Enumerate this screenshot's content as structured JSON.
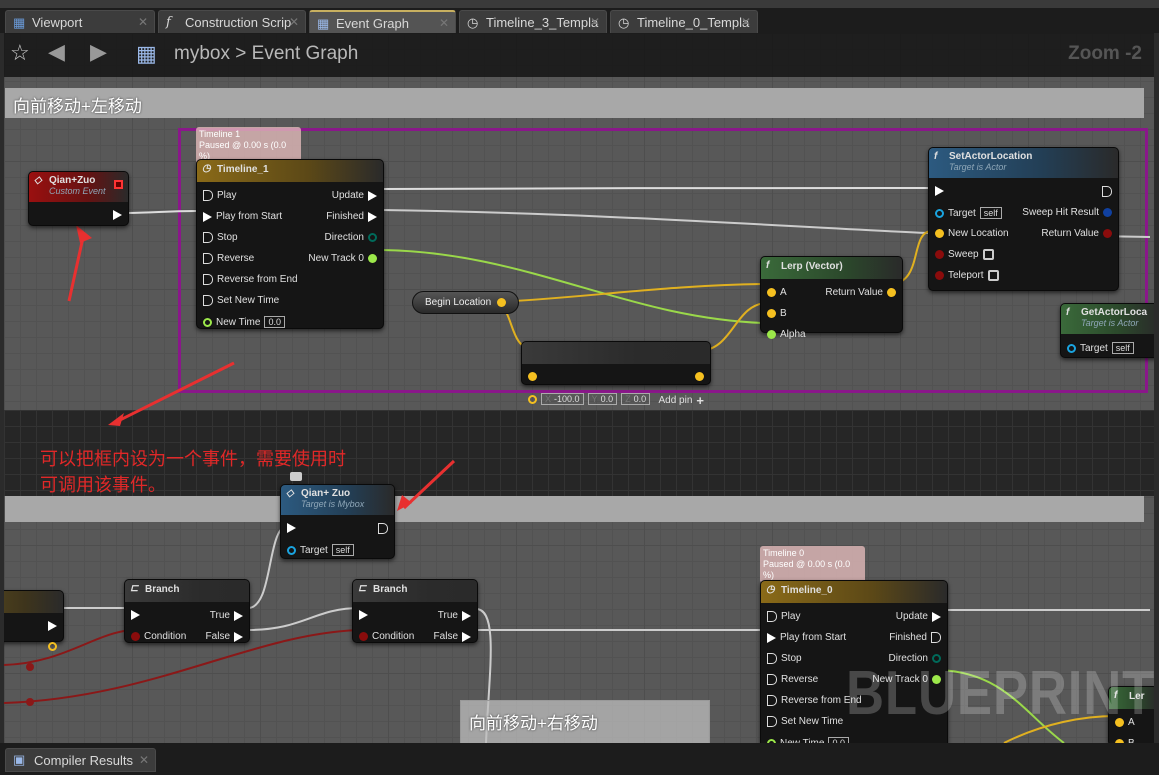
{
  "tabs": [
    {
      "label": "Viewport",
      "icon": "viewport-icon",
      "active": false
    },
    {
      "label": "Construction Scrip",
      "icon": "function-icon",
      "active": false
    },
    {
      "label": "Event Graph",
      "icon": "event-graph-icon",
      "active": true
    },
    {
      "label": "Timeline_3_Templa",
      "icon": "clock-icon",
      "active": false
    },
    {
      "label": "Timeline_0_Templa",
      "icon": "clock-icon",
      "active": false
    }
  ],
  "toolbar": {
    "breadcrumb_root": "mybox",
    "breadcrumb_sep": ">",
    "breadcrumb_current": "Event Graph",
    "zoom": "Zoom -2"
  },
  "comments": {
    "top": "向前移动+左移动",
    "middle": "",
    "bottom": "向前移动+右移动"
  },
  "annotation": {
    "line1": "可以把框内设为一个事件，需要使用时",
    "line2": "可调用该事件。"
  },
  "watermark": "BLUEPRINT",
  "tooltips": {
    "timeline1": {
      "line1": "Timeline 1",
      "line2": "Paused @ 0.00 s (0.0 %)"
    },
    "timeline0": {
      "line1": "Timeline 0",
      "line2": "Paused @ 0.00 s (0.0 %)"
    }
  },
  "begin_location": "Begin Location",
  "colors": {
    "exec": "#ffffff",
    "vector": "#f5c020",
    "float": "#9ce84a",
    "object": "#1aa4e0",
    "bool": "#8a0c0c",
    "struct": "#1040a0",
    "byte": "#006a5a",
    "comment_border": "#8a178a",
    "annotation": "#e02828"
  },
  "nodes": [
    {
      "id": "custom-event",
      "title": "Qian+Zuo",
      "subtitle": "Custom Event",
      "icon": "event-icon",
      "header": "#9a1010",
      "rows": [
        {
          "right": {
            "pin": "exec"
          }
        }
      ]
    },
    {
      "id": "timeline-1",
      "title": "Timeline_1",
      "icon": "clock-icon",
      "header": "#8a6a18",
      "rows": [
        {
          "left": {
            "pin": "exech",
            "label": "Play"
          },
          "right": {
            "pin": "exec",
            "label": "Update"
          }
        },
        {
          "left": {
            "pin": "exec",
            "label": "Play from Start"
          },
          "right": {
            "pin": "exec",
            "label": "Finished"
          }
        },
        {
          "left": {
            "pin": "exech",
            "label": "Stop"
          },
          "right": {
            "pin": "byte",
            "label": "Direction"
          }
        },
        {
          "left": {
            "pin": "exech",
            "label": "Reverse"
          },
          "right": {
            "pin": "float",
            "label": "New Track 0"
          }
        },
        {
          "left": {
            "pin": "exech",
            "label": "Reverse from End"
          }
        },
        {
          "left": {
            "pin": "exech",
            "label": "Set New Time"
          }
        },
        {
          "left": {
            "pin": "floath",
            "label": "New Time",
            "value": "0.0"
          }
        }
      ]
    },
    {
      "id": "make-vector",
      "title": "",
      "header": "#3a3a3a",
      "rows": [
        {
          "left": {
            "pin": "vector"
          },
          "right": {
            "pin": "vector"
          }
        },
        {
          "left": {
            "pin": "vectorh",
            "x": "X",
            "xv": "-100.0",
            "y": "Y",
            "yv": "0.0",
            "z": "Z",
            "zv": "0.0"
          },
          "right": {
            "label": "Add pin",
            "pin": "plus"
          }
        }
      ]
    },
    {
      "id": "lerp",
      "title": "Lerp (Vector)",
      "icon": "function-icon",
      "header": "#3a6a3a",
      "rows": [
        {
          "left": {
            "pin": "vector",
            "label": "A"
          },
          "right": {
            "pin": "vector",
            "label": "Return Value"
          }
        },
        {
          "left": {
            "pin": "vector",
            "label": "B"
          }
        },
        {
          "left": {
            "pin": "float",
            "label": "Alpha"
          }
        }
      ]
    },
    {
      "id": "set-actor-location",
      "title": "SetActorLocation",
      "subtitle": "Target is Actor",
      "icon": "function-icon",
      "header": "#2c5a80",
      "rows": [
        {
          "left": {
            "pin": "exec"
          },
          "right": {
            "pin": "exech"
          }
        },
        {
          "left": {
            "pin": "object",
            "label": "Target",
            "value": "self"
          },
          "right": {
            "pin": "struct",
            "label": "Sweep Hit Result"
          }
        },
        {
          "left": {
            "pin": "vector",
            "label": "New Location"
          },
          "right": {
            "pin": "bool",
            "label": "Return Value"
          }
        },
        {
          "left": {
            "pin": "bool",
            "label": "Sweep",
            "check": true
          }
        },
        {
          "left": {
            "pin": "bool",
            "label": "Teleport",
            "check": true
          }
        }
      ]
    },
    {
      "id": "get-actor-location",
      "title": "GetActorLoca",
      "subtitle": "Target is Actor",
      "icon": "function-icon",
      "header": "#3a6a3a",
      "rows": [
        {
          "left": {
            "pin": "object",
            "label": "Target",
            "value": "self"
          }
        }
      ]
    },
    {
      "id": "call-qian-zuo",
      "title": "Qian+ Zuo",
      "subtitle": "Target is Mybox",
      "icon": "event-icon",
      "header": "#2c5a80",
      "rows": [
        {
          "left": {
            "pin": "exec"
          },
          "right": {
            "pin": "exech"
          }
        },
        {
          "left": {
            "pin": "object",
            "label": "Target",
            "value": "self"
          }
        }
      ]
    },
    {
      "id": "partial-node",
      "title": "",
      "header": "#5a4a20",
      "rows": [
        {
          "right": {
            "pin": "exec"
          }
        },
        {
          "left": {
            "label": "tion"
          },
          "right": {
            "pin": "vectorh"
          }
        }
      ]
    },
    {
      "id": "branch-1",
      "title": "Branch",
      "icon": "branch-icon",
      "header": "#3a3a3a",
      "rows": [
        {
          "left": {
            "pin": "exec"
          },
          "right": {
            "pin": "exec",
            "label": "True"
          }
        },
        {
          "left": {
            "pin": "bool",
            "label": "Condition"
          },
          "right": {
            "pin": "exec",
            "label": "False"
          }
        }
      ]
    },
    {
      "id": "branch-2",
      "title": "Branch",
      "icon": "branch-icon",
      "header": "#3a3a3a",
      "rows": [
        {
          "left": {
            "pin": "exec"
          },
          "right": {
            "pin": "exec",
            "label": "True"
          }
        },
        {
          "left": {
            "pin": "bool",
            "label": "Condition"
          },
          "right": {
            "pin": "exec",
            "label": "False"
          }
        }
      ]
    },
    {
      "id": "timeline-0",
      "title": "Timeline_0",
      "icon": "clock-icon",
      "header": "#8a6a18",
      "rows": [
        {
          "left": {
            "pin": "exech",
            "label": "Play"
          },
          "right": {
            "pin": "exec",
            "label": "Update"
          }
        },
        {
          "left": {
            "pin": "exec",
            "label": "Play from Start"
          },
          "right": {
            "pin": "exech",
            "label": "Finished"
          }
        },
        {
          "left": {
            "pin": "exech",
            "label": "Stop"
          },
          "right": {
            "pin": "byte",
            "label": "Direction"
          }
        },
        {
          "left": {
            "pin": "exech",
            "label": "Reverse"
          },
          "right": {
            "pin": "float",
            "label": "New Track 0"
          }
        },
        {
          "left": {
            "pin": "exech",
            "label": "Reverse from End"
          }
        },
        {
          "left": {
            "pin": "exech",
            "label": "Set New Time"
          }
        },
        {
          "left": {
            "pin": "floath",
            "label": "New Time",
            "value": "0.0"
          }
        }
      ]
    },
    {
      "id": "lerp-partial",
      "title": "Ler",
      "icon": "function-icon",
      "header": "#3a6a3a",
      "rows": [
        {
          "left": {
            "pin": "vector",
            "label": "A"
          }
        },
        {
          "left": {
            "pin": "vector",
            "label": "B"
          }
        }
      ]
    }
  ],
  "bottom_panel": {
    "tab": "Compiler Results",
    "icon": "compiler-results-icon"
  }
}
